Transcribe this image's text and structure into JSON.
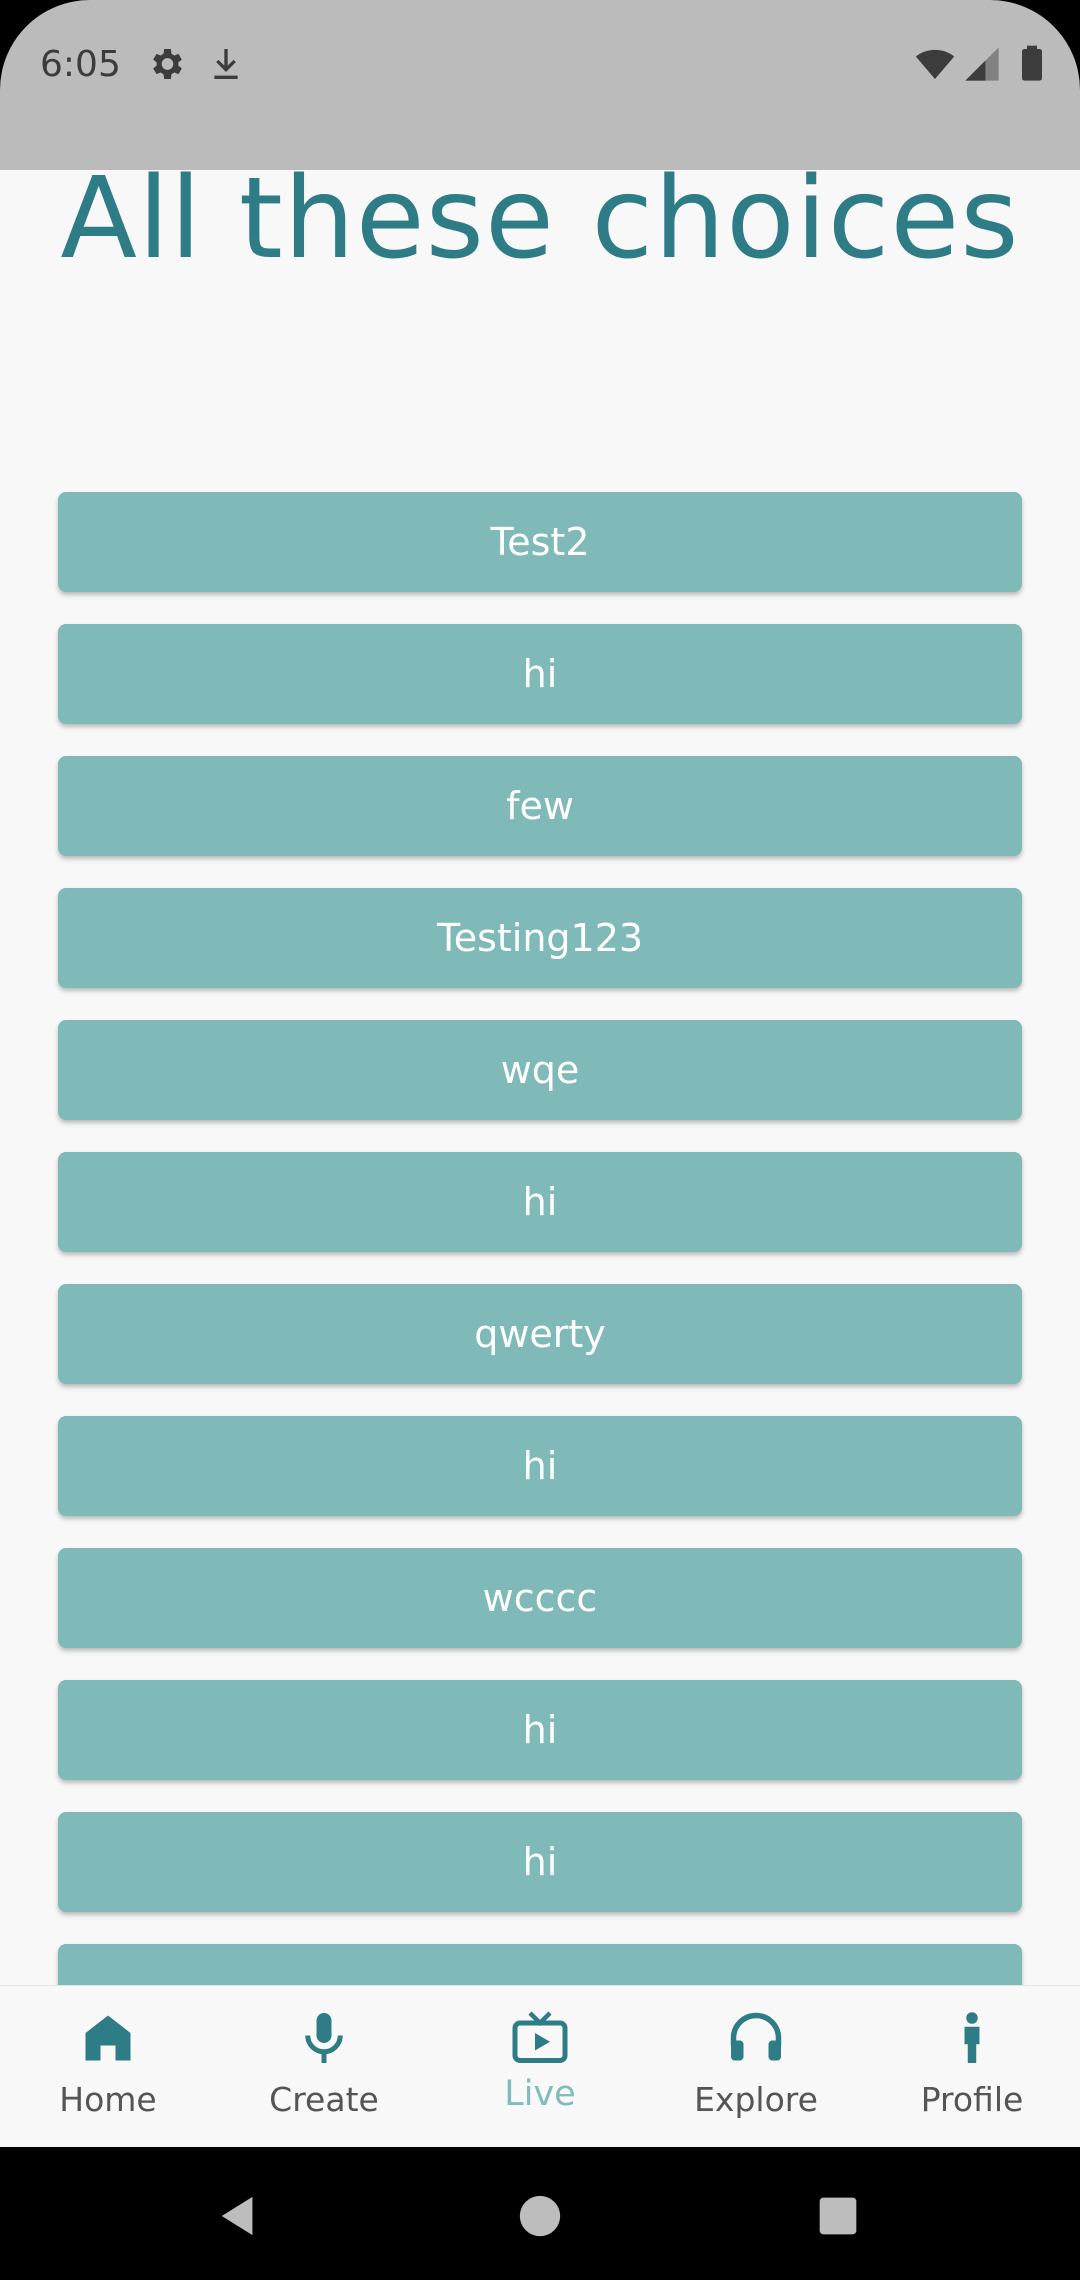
{
  "status_bar": {
    "time": "6:05",
    "icons": [
      "gear-icon",
      "download-icon",
      "wifi-icon",
      "signal-icon",
      "battery-icon"
    ]
  },
  "page": {
    "title": "All these choices"
  },
  "choices": [
    {
      "label": "Test2"
    },
    {
      "label": "hi"
    },
    {
      "label": "few"
    },
    {
      "label": "Testing123"
    },
    {
      "label": "wqe"
    },
    {
      "label": "hi"
    },
    {
      "label": "qwerty"
    },
    {
      "label": "hi"
    },
    {
      "label": "wcccc"
    },
    {
      "label": "hi"
    },
    {
      "label": "hi"
    },
    {
      "label": ""
    }
  ],
  "bottom_nav": {
    "items": [
      {
        "label": "Home",
        "icon": "home-icon",
        "active": false
      },
      {
        "label": "Create",
        "icon": "microphone-icon",
        "active": false
      },
      {
        "label": "Live",
        "icon": "tv-play-icon",
        "active": true
      },
      {
        "label": "Explore",
        "icon": "headphones-icon",
        "active": false
      },
      {
        "label": "Profile",
        "icon": "person-icon",
        "active": false
      }
    ]
  },
  "system_nav": {
    "buttons": [
      "back-icon",
      "home-circle-icon",
      "recents-icon"
    ]
  },
  "colors": {
    "accent": "#2e7d86",
    "choice_bg": "#7fb9b8",
    "active_nav": "#7fbcbb",
    "status_bar_bg": "#bbbbbb",
    "page_bg": "#f8f8f8"
  }
}
